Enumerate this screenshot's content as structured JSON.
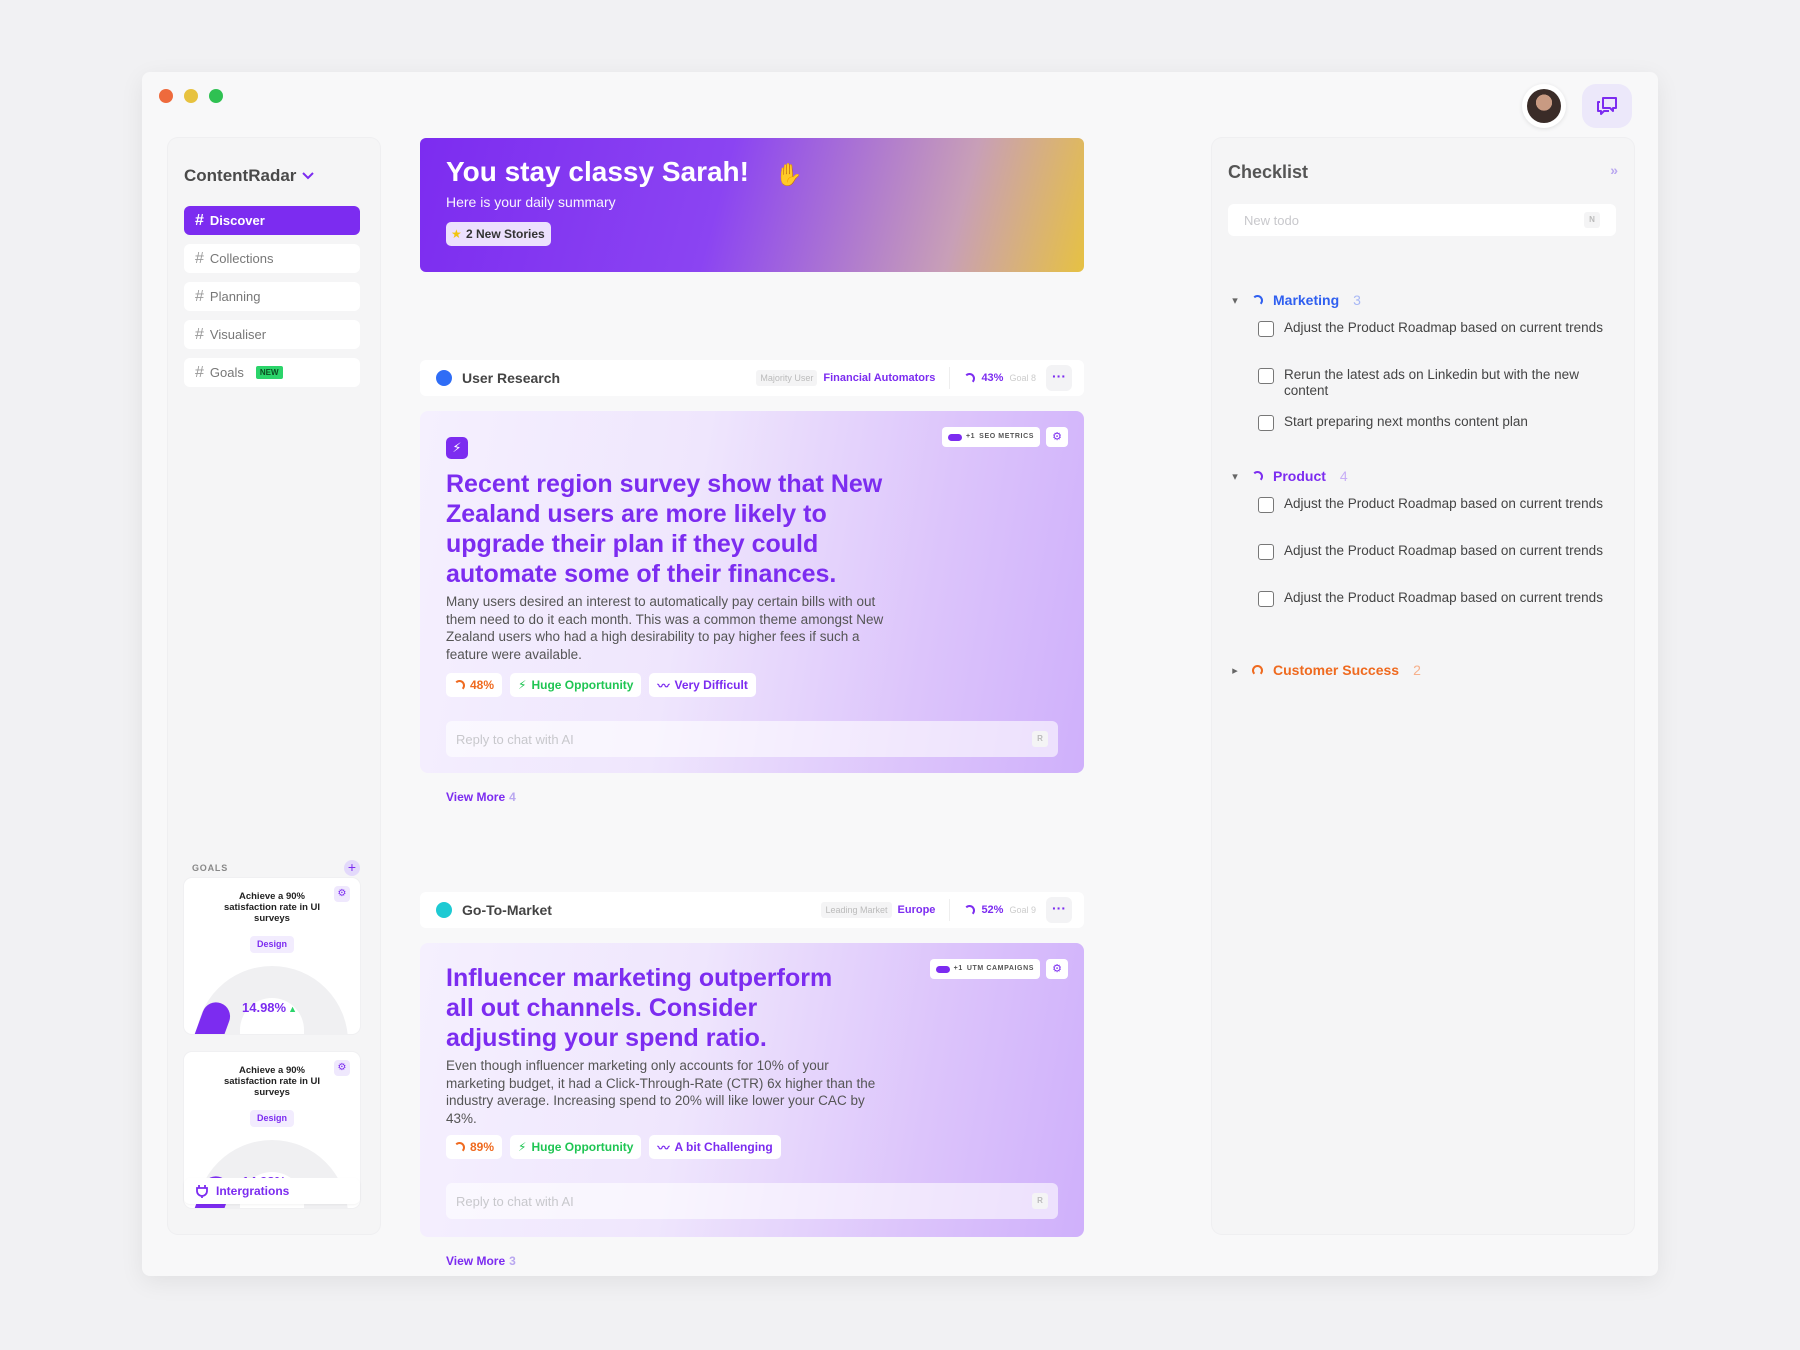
{
  "brand": {
    "name": "ContentRadar"
  },
  "nav": [
    {
      "label": "Discover",
      "active": true
    },
    {
      "label": "Collections"
    },
    {
      "label": "Planning"
    },
    {
      "label": "Visualiser"
    },
    {
      "label": "Goals",
      "badge": "NEW"
    }
  ],
  "goals": {
    "label": "GOALS",
    "cards": [
      {
        "title": "Achieve a 90% satisfaction rate in UI surveys",
        "tag": "Design",
        "value": "14.98%"
      },
      {
        "title": "Achieve a 90% satisfaction rate in UI surveys",
        "tag": "Design",
        "value": "14.98%"
      }
    ]
  },
  "integrations": {
    "label": "Intergrations"
  },
  "hero": {
    "title": "You stay classy Sarah!",
    "subtitle": "Here is your daily summary",
    "badge": "2 New Stories"
  },
  "sections": [
    {
      "name": "User Research",
      "dot_color": "#2f6df6",
      "meta_label": "Majority User",
      "meta_value": "Financial Automators",
      "percent": "43%",
      "goal": "Goal 8",
      "metric_tag": "SEO METRICS",
      "metric_count": "+1",
      "headline": "Recent region survey show that New Zealand users are more likely to upgrade their plan if they could automate some of their finances.",
      "body": "Many users desired an interest to automatically pay certain bills with out them need to do it each month. This was a common theme amongst New Zealand users who had a high desirability to pay higher fees if such a feature were available.",
      "chips": {
        "score": "48%",
        "opportunity": "Huge Opportunity",
        "difficulty": "Very Difficult"
      },
      "reply_placeholder": "Reply to chat with AI",
      "reply_key": "R",
      "view_more": "View More",
      "view_more_count": "4"
    },
    {
      "name": "Go-To-Market",
      "dot_color": "#1ecad3",
      "meta_label": "Leading Market",
      "meta_value": "Europe",
      "percent": "52%",
      "goal": "Goal 9",
      "metric_tag": "UTM CAMPAIGNS",
      "metric_count": "+1",
      "headline": "Influencer marketing outperform all out channels. Consider adjusting your spend ratio.",
      "body": "Even though influencer marketing only accounts for 10% of your marketing budget, it had a Click-Through-Rate (CTR) 6x higher than the industry average. Increasing spend to 20% will like lower your CAC by 43%.",
      "chips": {
        "score": "89%",
        "opportunity": "Huge Opportunity",
        "difficulty": "A bit Challenging"
      },
      "reply_placeholder": "Reply to chat with AI",
      "reply_key": "R",
      "view_more": "View More",
      "view_more_count": "3"
    }
  ],
  "checklist": {
    "title": "Checklist",
    "collapse_icon": "»",
    "input_placeholder": "New todo",
    "input_key": "N",
    "groups": [
      {
        "name": "Marketing",
        "count": "3",
        "color": "#2f5ff0",
        "expanded": true,
        "items": [
          "Adjust the Product Roadmap based on current trends",
          "Rerun the latest ads on Linkedin but with the new content",
          "Start preparing next months content plan"
        ]
      },
      {
        "name": "Product",
        "count": "4",
        "color": "#7c2cf0",
        "expanded": true,
        "items": [
          "Adjust the Product Roadmap based on current trends",
          "Adjust the Product Roadmap based on current trends",
          "Adjust the Product Roadmap based on current trends"
        ]
      },
      {
        "name": "Customer Success",
        "count": "2",
        "color": "#ef6a1f",
        "expanded": false,
        "items": []
      }
    ]
  },
  "icons": {
    "sidebar_brand_chevron": "chevron-down-icon",
    "chat": "chat-bubbles-icon",
    "goals_add": "plus-icon",
    "goal_settings": "gear-icon",
    "integrations": "plug-icon",
    "story": "bolt-icon",
    "opportunity": "bolt-icon",
    "difficulty": "pulse-icon"
  },
  "colors": {
    "accent": "#7c2cf0",
    "success": "#2bd46a",
    "warning": "#ef6a1f"
  }
}
